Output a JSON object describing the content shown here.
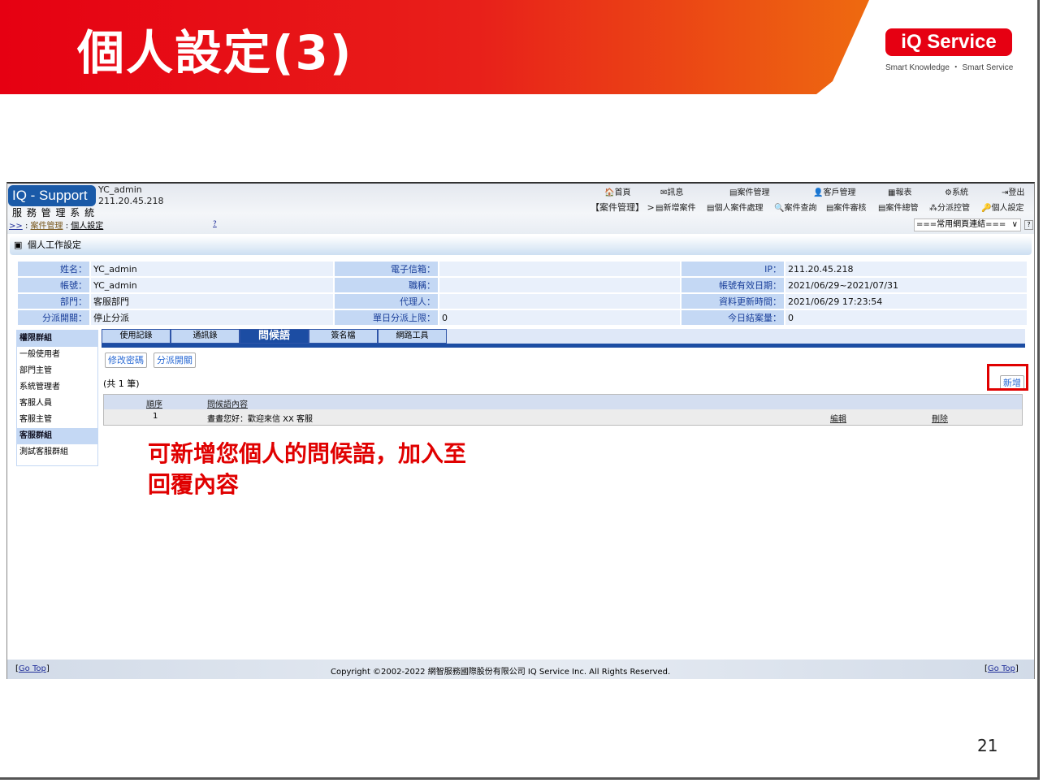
{
  "slide": {
    "title": "個人設定(3)",
    "page_number": "21",
    "logo_text": "iQ Service",
    "logo_tagline": "Smart Knowledge ・ Smart Service",
    "annotation": [
      "可新增您個人的問候語，加入至",
      "回覆內容"
    ]
  },
  "app": {
    "logo": "IQ - Support",
    "system_name": "服 務 管 理 系 統",
    "user": "YC_admin",
    "ip": "211.20.45.218",
    "breadcrumb": {
      "home": ">>",
      "sep": ":",
      "level1": "案件管理",
      "level2": "個人設定",
      "extra": "?"
    },
    "top_menu": [
      "首頁",
      "訊息",
      "案件管理",
      "客戶管理",
      "報表",
      "系統",
      "登出"
    ],
    "sub_menu_prefix": "【案件管理】 >",
    "sub_menu": [
      "新增案件",
      "個人案件處理",
      "案件查詢",
      "案件審核",
      "案件總管",
      "分派控管",
      "個人設定"
    ],
    "quick_links": "===常用網頁連結===",
    "section_title": "個人工作設定",
    "info": [
      [
        {
          "label": "姓名：",
          "value": "YC_admin"
        },
        {
          "label": "電子信箱：",
          "value": ""
        },
        {
          "label": "IP：",
          "value": "211.20.45.218"
        }
      ],
      [
        {
          "label": "帳號：",
          "value": "YC_admin"
        },
        {
          "label": "職稱：",
          "value": ""
        },
        {
          "label": "帳號有效日期：",
          "value": "2021/06/29~2021/07/31"
        }
      ],
      [
        {
          "label": "部門：",
          "value": "客服部門"
        },
        {
          "label": "代理人：",
          "value": ""
        },
        {
          "label": "資料更新時間：",
          "value": "2021/06/29 17:23:54"
        }
      ],
      [
        {
          "label": "分派開關：",
          "value": "停止分派"
        },
        {
          "label": "單日分派上限：",
          "value": "0"
        },
        {
          "label": "今日結案量：",
          "value": "0"
        }
      ]
    ],
    "sidebar": {
      "perm_header": "權限群組",
      "perm_items": [
        "一般使用者",
        "部門主管",
        "系統管理者",
        "客服人員",
        "客服主管"
      ],
      "group_header": "客服群組",
      "group_items": [
        "測試客服群組"
      ]
    },
    "tabs": [
      "使用記錄",
      "通訊錄",
      "問候語",
      "簽名檔",
      "網路工具"
    ],
    "active_tab": 2,
    "buttons": {
      "change_password": "修改密碼",
      "dispatch_switch": "分派開關",
      "add": "新增"
    },
    "count_text": "(共 1 筆)",
    "table": {
      "headers": [
        "順序",
        "問候語內容"
      ],
      "rows": [
        {
          "order": "1",
          "content": "晝晝您好：歡迎來信 XX 客服",
          "edit": "編輯",
          "delete": "刪除"
        }
      ]
    },
    "footer": {
      "go_top": "Go Top",
      "copyright": "Copyright ©2002-2022 網智服務國際股份有限公司 IQ Service Inc. All Rights Reserved."
    }
  },
  "colors": {
    "brand_red": "#e60012",
    "app_blue": "#1c4da3",
    "annotation_red": "#e00000"
  }
}
